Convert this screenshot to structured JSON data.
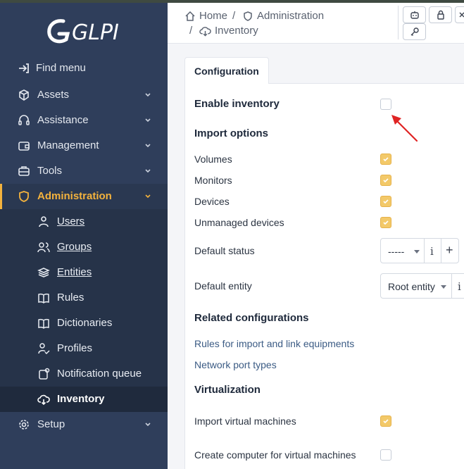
{
  "app": {
    "logo_text": "GLPI"
  },
  "breadcrumb": {
    "home": "Home",
    "separator": "/",
    "administration": "Administration",
    "inventory": "Inventory"
  },
  "sidebar": {
    "items": [
      {
        "label": "Find menu",
        "icon": "arrow-right-to-bracket-icon"
      },
      {
        "label": "Assets",
        "icon": "cube-icon"
      },
      {
        "label": "Assistance",
        "icon": "headset-icon"
      },
      {
        "label": "Management",
        "icon": "wallet-icon"
      },
      {
        "label": "Tools",
        "icon": "briefcase-icon"
      },
      {
        "label": "Administration",
        "icon": "shield-icon"
      },
      {
        "label": "Setup",
        "icon": "gear-icon"
      }
    ],
    "submenu": [
      {
        "label": "Users",
        "icon": "user-icon"
      },
      {
        "label": "Groups",
        "icon": "users-icon"
      },
      {
        "label": "Entities",
        "icon": "stack-icon"
      },
      {
        "label": "Rules",
        "icon": "book-icon"
      },
      {
        "label": "Dictionaries",
        "icon": "book-open-icon"
      },
      {
        "label": "Profiles",
        "icon": "user-check-icon"
      },
      {
        "label": "Notification queue",
        "icon": "notification-icon"
      },
      {
        "label": "Inventory",
        "icon": "cloud-download-icon"
      }
    ]
  },
  "tab": {
    "label": "Configuration"
  },
  "form": {
    "enable_inventory": {
      "label": "Enable inventory",
      "checked": false
    },
    "import_options_title": "Import options",
    "volumes": {
      "label": "Volumes",
      "checked": true
    },
    "monitors": {
      "label": "Monitors",
      "checked": true
    },
    "devices": {
      "label": "Devices",
      "checked": true
    },
    "unmanaged": {
      "label": "Unmanaged devices",
      "checked": true
    },
    "default_status": {
      "label": "Default status",
      "value": "-----",
      "info": "i",
      "add": "+"
    },
    "default_entity": {
      "label": "Default entity",
      "value": "Root entity",
      "info": "i"
    },
    "related_title": "Related configurations",
    "rules_link": "Rules for import and link equipments",
    "port_types_link": "Network port types",
    "virtualization_title": "Virtualization",
    "import_vm": {
      "label": "Import virtual machines",
      "checked": true
    },
    "create_computer_vm": {
      "label": "Create computer for virtual machines",
      "checked": false
    }
  },
  "colors": {
    "accent": "#f3b23d",
    "sidebar_bg": "#2f3e5b",
    "annotation_arrow": "#e02424"
  }
}
